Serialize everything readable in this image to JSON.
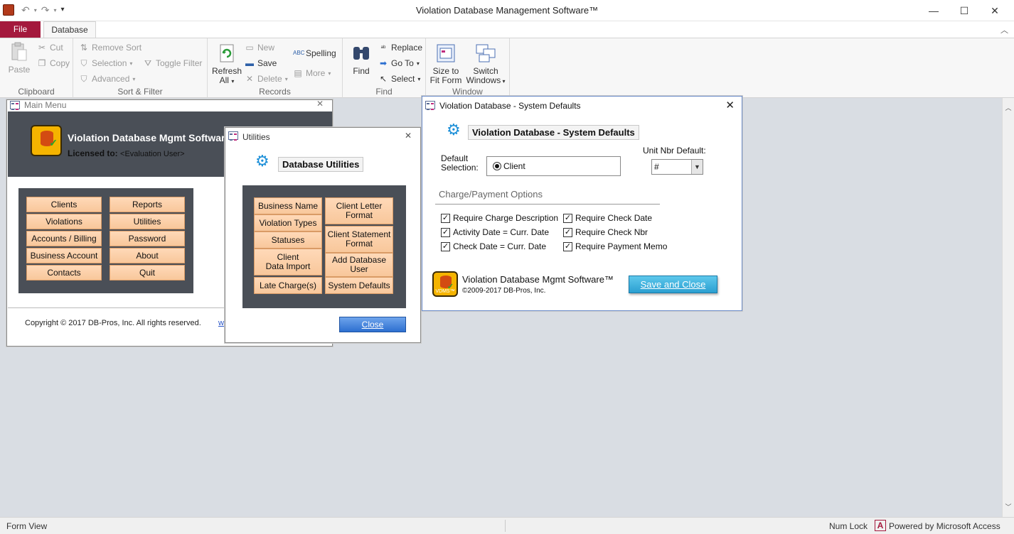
{
  "app": {
    "window_title": "Violation Database Management Software™"
  },
  "tabs": {
    "file": "File",
    "database": "Database"
  },
  "ribbon": {
    "clipboard": {
      "label": "Clipboard",
      "paste": "Paste",
      "cut": "Cut",
      "copy": "Copy"
    },
    "sort_filter": {
      "label": "Sort & Filter",
      "remove_sort": "Remove Sort",
      "selection": "Selection",
      "advanced": "Advanced",
      "toggle_filter": "Toggle Filter"
    },
    "records": {
      "label": "Records",
      "refresh_all_1": "Refresh",
      "refresh_all_2": "All",
      "new": "New",
      "save": "Save",
      "delete": "Delete",
      "spelling": "Spelling",
      "more": "More"
    },
    "find": {
      "label": "Find",
      "find": "Find",
      "replace": "Replace",
      "go_to": "Go To",
      "select": "Select"
    },
    "window": {
      "label": "Window",
      "size_to_fit_1": "Size to",
      "size_to_fit_2": "Fit Form",
      "switch_windows_1": "Switch",
      "switch_windows_2": "Windows"
    }
  },
  "main_menu": {
    "title": "Main Menu",
    "app_name": "Violation Database Mgmt Software™",
    "licensed_label": "Licensed to:",
    "licensed_value": "<Evaluation User>",
    "buttons_left": [
      "Clients",
      "Violations",
      "Accounts / Billing",
      "Business Account",
      "Contacts"
    ],
    "buttons_right": [
      "Reports",
      "Utilities",
      "Password",
      "About",
      "Quit"
    ],
    "copyright": "Copyright © 2017 DB-Pros, Inc.  All rights reserved.",
    "link_fragment": "w"
  },
  "utilities": {
    "title": "Utilities",
    "heading": "Database Utilities",
    "left_buttons": [
      "Business Name",
      "Violation Types",
      "Statuses",
      "Client\nData Import",
      "Late Charge(s)"
    ],
    "right_buttons": [
      "Client Letter\nFormat",
      "Client Statement\nFormat",
      "Add Database\nUser",
      "System Defaults"
    ],
    "close": "Close"
  },
  "system_defaults": {
    "title": "Violation Database - System Defaults",
    "heading": "Violation Database - System Defaults",
    "default_selection_label": "Default\nSelection:",
    "radio_value": "Client",
    "unit_nbr_label": "Unit Nbr Default:",
    "unit_nbr_value": "#",
    "section_title": "Charge/Payment Options",
    "options_left": [
      "Require Charge Description",
      "Activity Date = Curr. Date",
      "Check Date = Curr. Date"
    ],
    "options_right": [
      "Require Check Date",
      "Require Check Nbr",
      "Require Payment Memo"
    ],
    "footer_name": "Violation Database Mgmt Software™",
    "footer_copy": "©2009-2017 DB-Pros, Inc.",
    "save_close": "Save and Close",
    "logo_text": "VDMS™"
  },
  "statusbar": {
    "left": "Form View",
    "num_lock": "Num Lock",
    "powered": "Powered by Microsoft Access"
  },
  "colors": {
    "file_tab": "#a4193d",
    "orange_button": "#f8c79b",
    "dark_panel": "#4a4f57",
    "accent_blue": "#2d6fd0",
    "teal_button": "#2b9fd1"
  }
}
